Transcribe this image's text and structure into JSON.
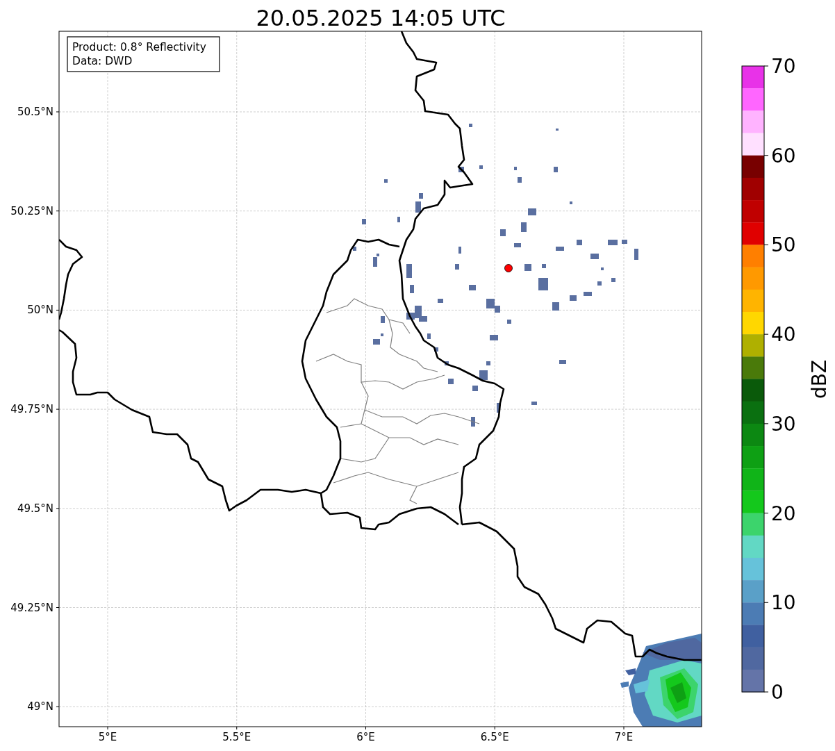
{
  "title": "20.05.2025 14:05 UTC",
  "info_box": [
    "Product: 0.8° Reflectivity",
    "Data: DWD"
  ],
  "map": {
    "lat_labels": [
      "50.5°N",
      "50.25°N",
      "50°N",
      "49.75°N",
      "49.5°N",
      "49.25°N",
      "49°N"
    ],
    "lon_labels": [
      "5°E",
      "5.5°E",
      "6°E",
      "6.5°E",
      "7°E"
    ]
  },
  "colorbar": {
    "label": "dBZ",
    "ticks": [
      "70",
      "60",
      "50",
      "40",
      "30",
      "20",
      "10",
      "0"
    ],
    "segments": [
      {
        "color": "#e832e8"
      },
      {
        "color": "#ff66ff"
      },
      {
        "color": "#ffb3ff"
      },
      {
        "color": "#ffe0ff"
      },
      {
        "color": "#780000"
      },
      {
        "color": "#a00000"
      },
      {
        "color": "#c00000"
      },
      {
        "color": "#e00000"
      },
      {
        "color": "#ff7f00"
      },
      {
        "color": "#ff9900"
      },
      {
        "color": "#ffb400"
      },
      {
        "color": "#ffd700"
      },
      {
        "color": "#afb000"
      },
      {
        "color": "#4a7a0a"
      },
      {
        "color": "#0a5a0a"
      },
      {
        "color": "#0a7010"
      },
      {
        "color": "#0c8812"
      },
      {
        "color": "#0ea014"
      },
      {
        "color": "#10b418"
      },
      {
        "color": "#14c81c"
      },
      {
        "color": "#3cd46c"
      },
      {
        "color": "#62d8c4"
      },
      {
        "color": "#66c2da"
      },
      {
        "color": "#5aa0c8"
      },
      {
        "color": "#4c7cb4"
      },
      {
        "color": "#4060a0"
      },
      {
        "color": "#5068a0"
      },
      {
        "color": "#6474a8"
      }
    ]
  }
}
